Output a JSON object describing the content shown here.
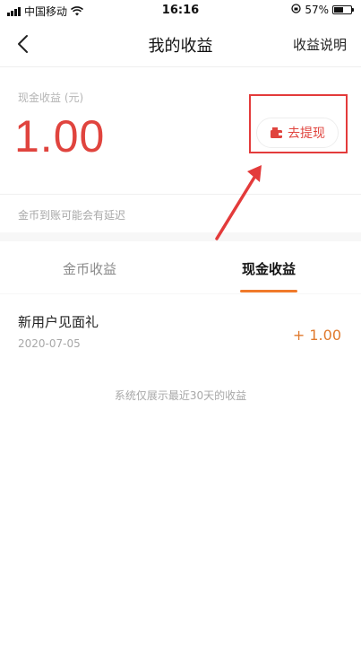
{
  "status_bar": {
    "carrier": "中国移动",
    "time": "16:16",
    "battery_percent": "57%",
    "battery_level": 0.57
  },
  "nav": {
    "title": "我的收益",
    "help_label": "收益说明",
    "back_icon": "chevron-left-icon"
  },
  "earnings": {
    "cash_label": "现金收益 (元)",
    "cash_amount": "1.00",
    "withdraw_label": "去提现",
    "withdraw_icon": "wallet-icon",
    "delay_note": "金币到账可能会有延迟"
  },
  "tabs": [
    {
      "label": "金币收益",
      "active": false
    },
    {
      "label": "现金收益",
      "active": true
    }
  ],
  "records": [
    {
      "title": "新用户见面礼",
      "date": "2020-07-05",
      "amount": "+ 1.00"
    }
  ],
  "list_note": "系统仅展示最近30天的收益",
  "colors": {
    "accent_red": "#e0443e",
    "highlight_red": "#e33b3b",
    "tab_underline": "#f07a2a",
    "amount_orange": "#e07a2e"
  }
}
